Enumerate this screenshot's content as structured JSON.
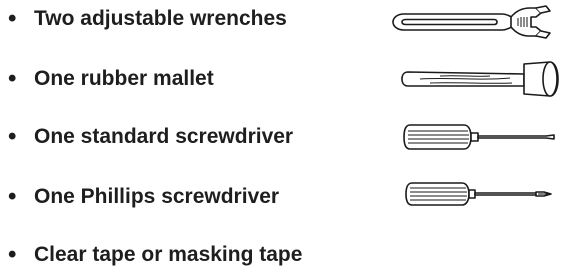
{
  "items": [
    {
      "bullet": "•",
      "label": "Two adjustable wrenches",
      "icon": "adjustable-wrench-icon"
    },
    {
      "bullet": "•",
      "label": "One rubber mallet",
      "icon": "rubber-mallet-icon"
    },
    {
      "bullet": "•",
      "label": "One standard screwdriver",
      "icon": "standard-screwdriver-icon"
    },
    {
      "bullet": "•",
      "label": "One Phillips screwdriver",
      "icon": "phillips-screwdriver-icon"
    },
    {
      "bullet": "•",
      "label": "Clear tape or masking tape"
    }
  ]
}
